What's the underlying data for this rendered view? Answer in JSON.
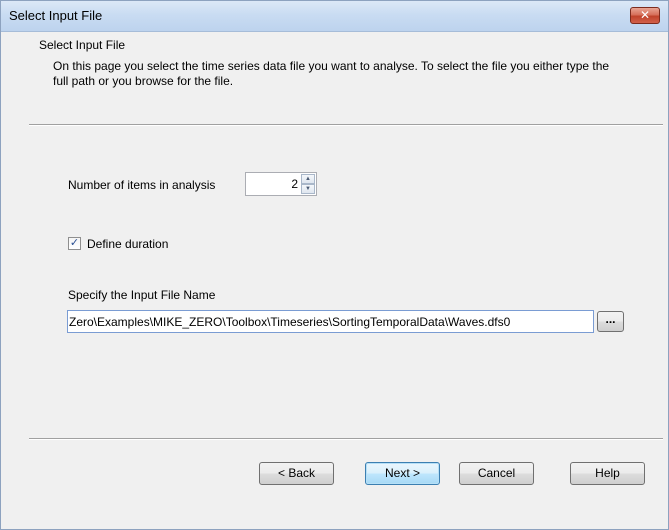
{
  "window": {
    "title": "Select Input File",
    "close_icon": "close-icon",
    "close_glyph": "✕"
  },
  "page": {
    "heading": "Select Input File",
    "description": "On this page you select the time series data file you want to analyse. To select the file you either type the full path or you browse for the file."
  },
  "items": {
    "label": "Number of items in analysis",
    "value": "2",
    "up_glyph": "▲",
    "down_glyph": "▼"
  },
  "duration": {
    "label": "Define duration",
    "checked": true,
    "check_glyph": "✓"
  },
  "input_file": {
    "label": "Specify the Input File Name",
    "value": "Zero\\Examples\\MIKE_ZERO\\Toolbox\\Timeseries\\SortingTemporalData\\Waves.dfs0",
    "browse_label": "..."
  },
  "buttons": {
    "back": "< Back",
    "next": "Next >",
    "cancel": "Cancel",
    "help": "Help"
  },
  "colors": {
    "title_bar": "#c9dcf2",
    "close_button": "#c0432b",
    "dialog_bg": "#f0f0f0",
    "default_button_border": "#3c7fb1"
  }
}
